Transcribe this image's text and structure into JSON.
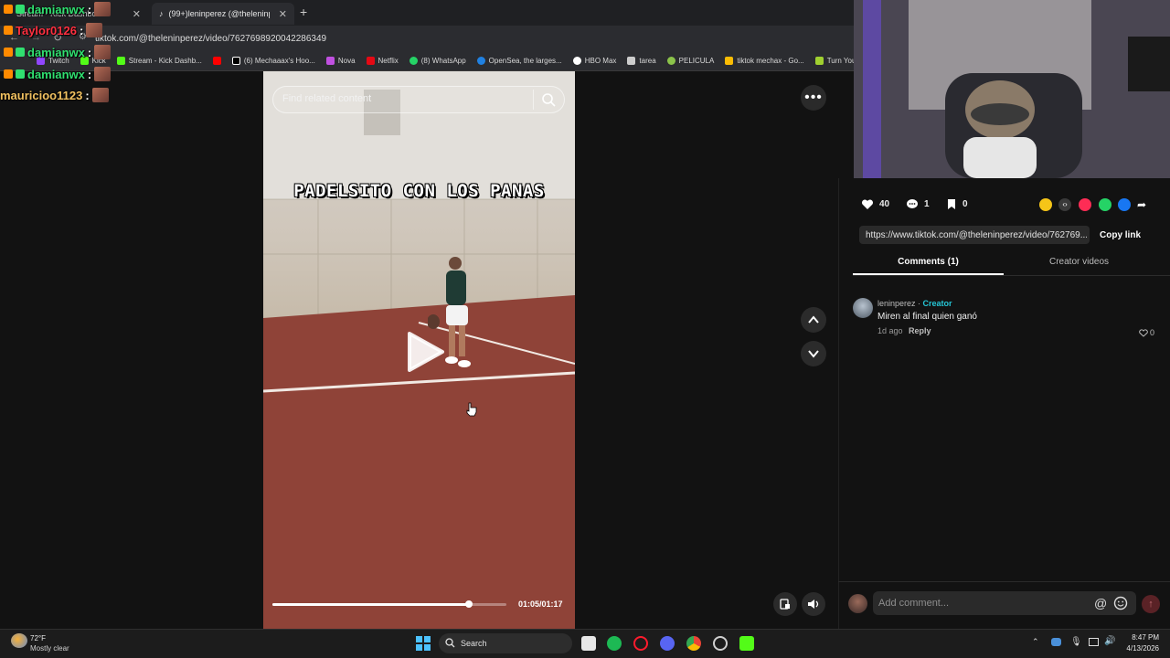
{
  "browser": {
    "tabs": [
      {
        "label": "Stream - Kick Dashboard"
      },
      {
        "label": "(99+)leninperez (@theleninpere"
      }
    ],
    "url": "tiktok.com/@theleninperez/video/7627698920042286349",
    "bookmarks": [
      {
        "label": "Twitch",
        "color": "#9146ff"
      },
      {
        "label": "Kick",
        "color": "#53fc18"
      },
      {
        "label": "Stream - Kick Dashb...",
        "color": "#53fc18"
      },
      {
        "label": "",
        "color": "#ff0000"
      },
      {
        "label": "(6) Mechaaax's Hoo...",
        "color": "#ffffff"
      },
      {
        "label": "Nova",
        "color": "#c050e0"
      },
      {
        "label": "Netflix",
        "color": "#e50914"
      },
      {
        "label": "(8) WhatsApp",
        "color": "#25d366"
      },
      {
        "label": "OpenSea, the larges...",
        "color": "#2081e2"
      },
      {
        "label": "HBO Max",
        "color": "#ffffff"
      },
      {
        "label": "tarea",
        "color": "#cccccc"
      },
      {
        "label": "PELICULA",
        "color": "#8bc34a"
      },
      {
        "label": "tiktok mechax - Go...",
        "color": "#fbbc04"
      },
      {
        "label": "Turn You",
        "color": "#a0d030"
      }
    ]
  },
  "chat_overlay": [
    {
      "user": "damianwx",
      "sep": ":",
      "color": "#30e070"
    },
    {
      "user": "Taylor0126",
      "sep": ":",
      "color": "#ff3040"
    },
    {
      "user": "damianwx",
      "sep": ":",
      "color": "#30e070"
    },
    {
      "user": "damianwx",
      "sep": ":",
      "color": "#30e070"
    },
    {
      "user": "mauricioo1123",
      "sep": ":",
      "color": "#f0c060"
    }
  ],
  "video": {
    "search_placeholder": "Find related content",
    "caption": "PADELSITO CON LOS PANAS",
    "time": "01:05/01:17",
    "progress": 0.84
  },
  "stats": {
    "likes": "40",
    "comments": "1",
    "saves": "0"
  },
  "share_colors": [
    "#f5c518",
    "#3a3a3a",
    "#fe2c55",
    "#25d366",
    "#1877f2"
  ],
  "link": {
    "url": "https://www.tiktok.com/@theleninperez/video/762769...",
    "copy_label": "Copy link"
  },
  "tabs": {
    "comments": "Comments (1)",
    "creator": "Creator videos"
  },
  "comment": {
    "user": "leninperez",
    "dot": " · ",
    "role": "Creator",
    "text": "Miren al final quien ganó",
    "time": "1d ago",
    "reply": "Reply",
    "likes": "0"
  },
  "composer": {
    "placeholder": "Add comment..."
  },
  "taskbar": {
    "weather_temp": "72°F",
    "weather_desc": "Mostly clear",
    "search_label": "Search",
    "time": "8:47 PM",
    "date": "4/13/2026"
  }
}
